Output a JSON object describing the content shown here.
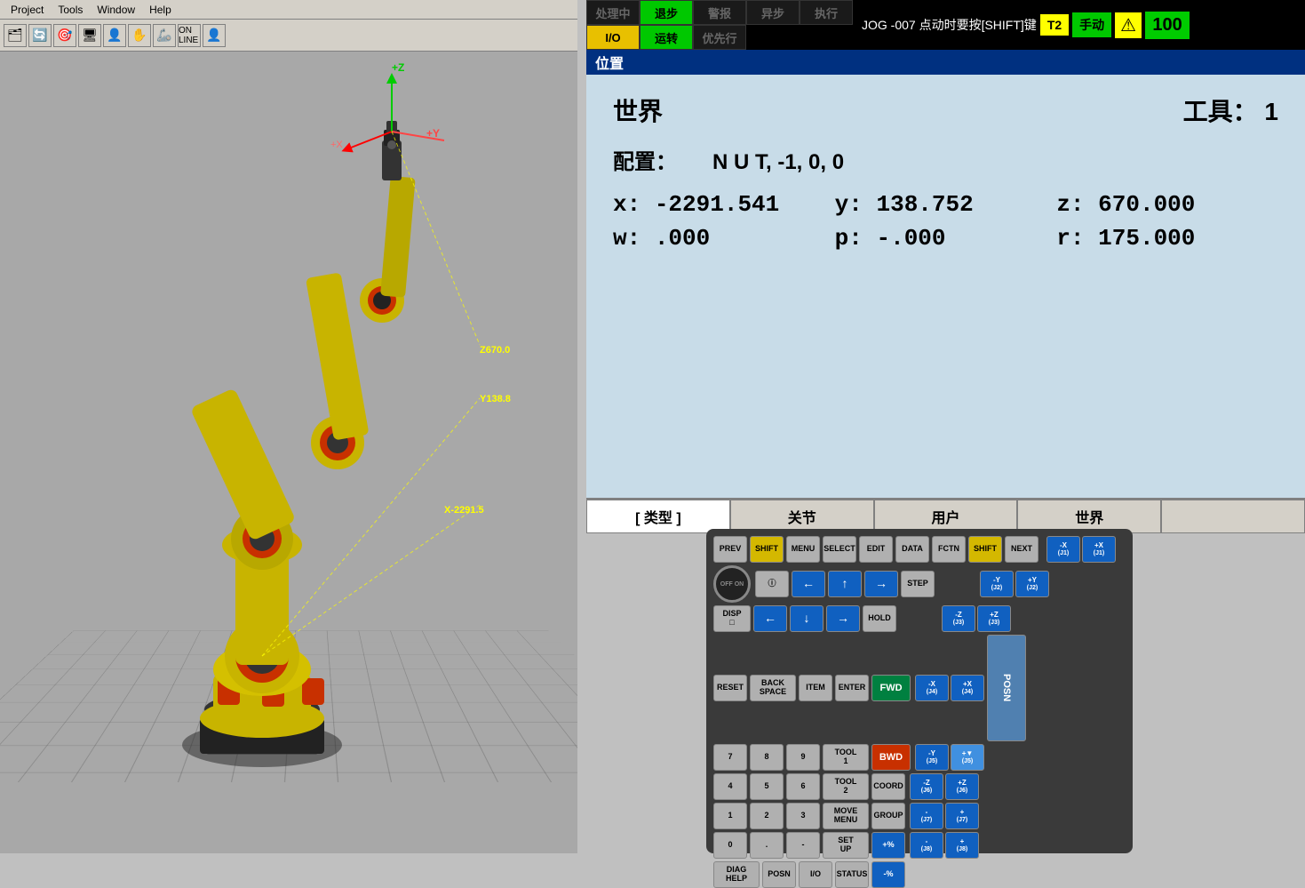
{
  "menubar": {
    "items": [
      "Project",
      "Tools",
      "Window",
      "Help"
    ]
  },
  "toolbar": {
    "icons": [
      "grid",
      "rotate",
      "target",
      "monitor",
      "person",
      "hand",
      "arm",
      "online",
      "person2"
    ]
  },
  "status": {
    "cells": [
      {
        "label": "处理中",
        "style": "dark",
        "row": 1,
        "col": 1
      },
      {
        "label": "退步",
        "style": "green",
        "row": 1,
        "col": 2
      },
      {
        "label": "警报",
        "style": "dark",
        "row": 1,
        "col": 3
      },
      {
        "label": "异步",
        "style": "dark",
        "row": 1,
        "col": 4
      },
      {
        "label": "执行",
        "style": "dark",
        "row": 2,
        "col": 1
      },
      {
        "label": "I/O",
        "style": "yellow",
        "row": 2,
        "col": 2
      },
      {
        "label": "运转",
        "style": "green",
        "row": 2,
        "col": 3
      },
      {
        "label": "优先行",
        "style": "dark",
        "row": 2,
        "col": 4
      }
    ],
    "jog_message": "JOG -007 点动时要按[SHIFT]键",
    "t2": "T2",
    "manual": "手动",
    "percentage": "100"
  },
  "position": {
    "header": "位置",
    "world_label": "世界",
    "tool_label": "工具：",
    "tool_value": "1",
    "config_label": "配置：",
    "config_value": "N U T, -1, 0, 0",
    "x_label": "x:",
    "x_value": "-2291.541",
    "y_label": "y:",
    "y_value": "138.752",
    "z_label": "z:",
    "z_value": "670.000",
    "w_label": "w:",
    "w_value": ".000",
    "p_label": "p:",
    "p_value": "-.000",
    "r_label": "r:",
    "r_value": "175.000"
  },
  "nav_tabs": {
    "items": [
      "[ 类型 ]",
      "关节",
      "用户",
      "世界",
      ""
    ]
  },
  "robot": {
    "z_coord": "Z670.0",
    "y_coord": "Y138.8",
    "x_coord": "X-2291.5"
  },
  "pendant": {
    "top_row": [
      "PREV",
      "SHIFT",
      "MENU",
      "SELECT",
      "EDIT",
      "DATA",
      "FCTN",
      "SHIFT",
      "NEXT"
    ],
    "row2": [
      "i",
      "←",
      "↑",
      "→",
      "STEP"
    ],
    "row3": [
      "DISP □",
      "←",
      "↓",
      "→",
      "HOLD"
    ],
    "row4": [
      "RESET",
      "BACK SPACE",
      "ITEM",
      "ENTER",
      "FWD"
    ],
    "row5": [
      "7",
      "8",
      "9",
      "TOOL 1",
      "BWD"
    ],
    "row6": [
      "4",
      "5",
      "6",
      "TOOL 2",
      "COORD"
    ],
    "row7": [
      "1",
      "2",
      "3",
      "MOVE MENU",
      "GROUP"
    ],
    "row8": [
      "0",
      ".",
      "-",
      "SET UP",
      "+%"
    ],
    "row9": [
      "DIAG HELP",
      "POSN",
      "I/O",
      "STATUS",
      "-%"
    ],
    "right_col": [
      "-X (J1)",
      "+X (J1)",
      "-Y (J2)",
      "+Y (J2)",
      "-Z (J3)",
      "+Z (J3)",
      "-X (J4)",
      "+X (J4)",
      "-Y (J5)",
      "+Y (J5)",
      "-Z (J6)",
      "+Z (J6)",
      "- (J7)",
      "+ (J7)",
      "- (J8)",
      "+ (J8)"
    ],
    "posn_label": "POSN"
  }
}
